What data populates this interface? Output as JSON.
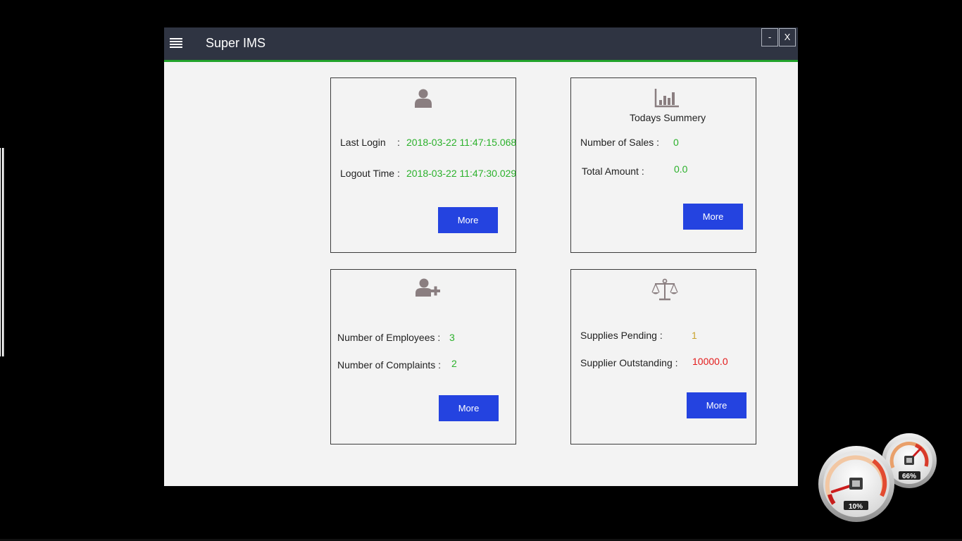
{
  "app": {
    "title": "Super IMS"
  },
  "window_controls": {
    "minimize_label": "-",
    "close_label": "X"
  },
  "login_card": {
    "icon": "user-icon",
    "last_login_label": "Last Login",
    "last_login_sep": ":",
    "last_login_value": "2018-03-22 11:47:15.068",
    "logout_label": "Logout Time :",
    "logout_value": "2018-03-22 11:47:30.029",
    "more_label": "More"
  },
  "summary_card": {
    "icon": "bar-chart-icon",
    "title": "Todays Summery",
    "sales_label": "Number of Sales :",
    "sales_value": "0",
    "amount_label": "Total Amount :",
    "amount_value": "0.0",
    "more_label": "More"
  },
  "employee_card": {
    "icon": "user-add-icon",
    "employees_label": "Number of Employees :",
    "employees_value": "3",
    "complaints_label": "Number of  Complaints :",
    "complaints_value": "2",
    "more_label": "More"
  },
  "supplier_card": {
    "icon": "balance-scale-icon",
    "pending_label": "Supplies Pending :",
    "pending_value": "1",
    "outstanding_label": "Supplier Outstanding :",
    "outstanding_value": "10000.0",
    "more_label": "More"
  },
  "gadget": {
    "cpu_percent": "10%",
    "memory_percent": "66%",
    "cpu_fraction": 0.1,
    "memory_fraction": 0.66
  },
  "colors": {
    "titlebar": "#2f3442",
    "accent_green": "#22a32b",
    "button_blue": "#2443e0",
    "value_green": "#2bb12b",
    "value_amber": "#c9a22b",
    "value_red": "#e31a1a"
  }
}
